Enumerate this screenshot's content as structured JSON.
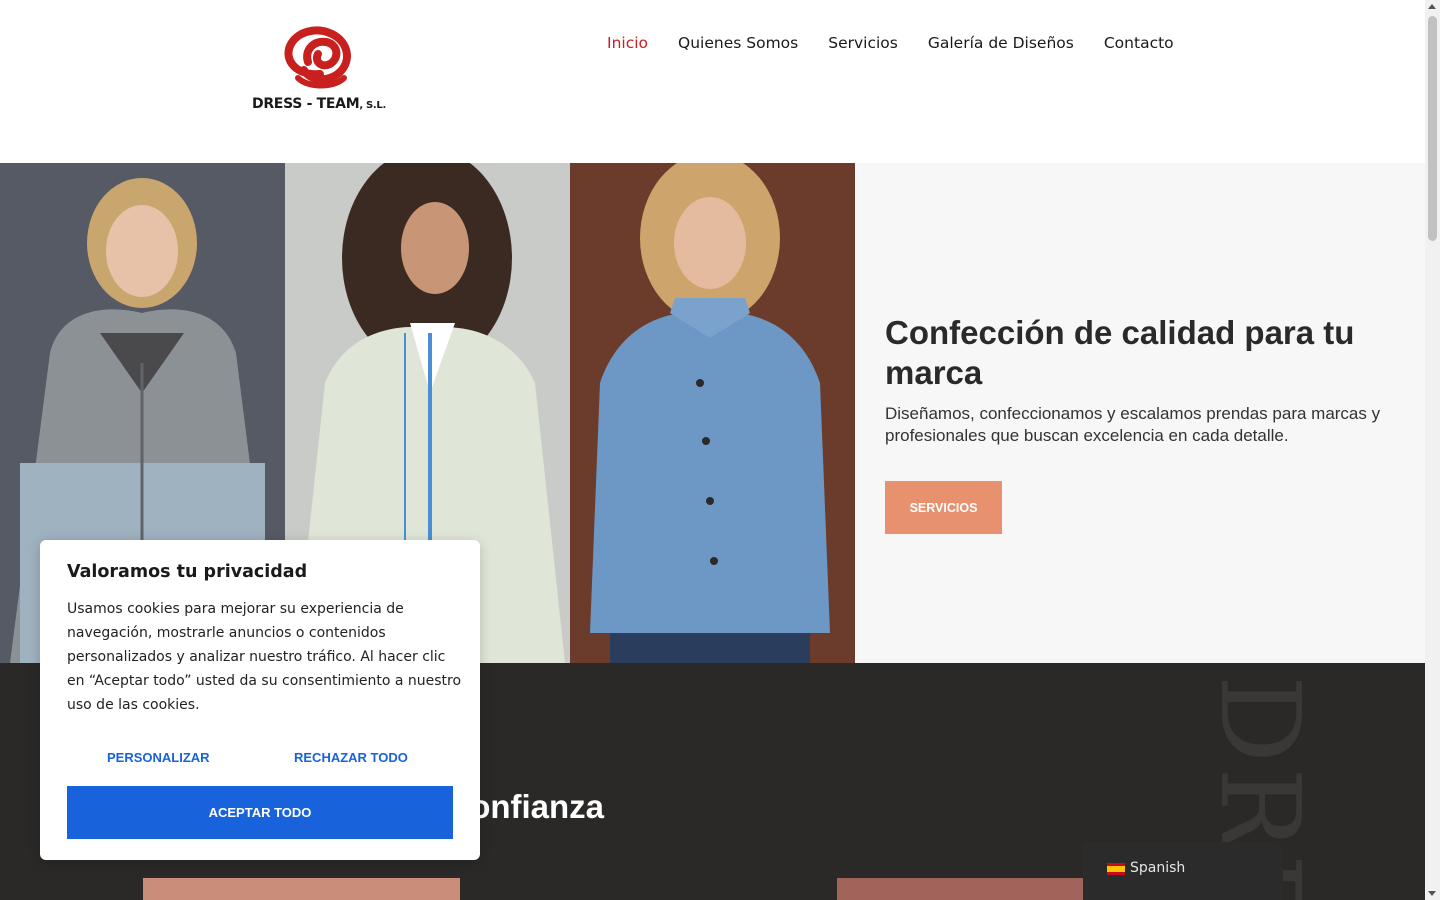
{
  "header": {
    "logo_text": "DRESS - TEAM",
    "logo_suffix": ", S.L.",
    "nav": [
      {
        "label": "Inicio",
        "active": true
      },
      {
        "label": "Quienes Somos"
      },
      {
        "label": "Servicios"
      },
      {
        "label": "Galería de Diseños"
      },
      {
        "label": "Contacto"
      }
    ]
  },
  "hero": {
    "title": "Confección de calidad para tu marca",
    "subtitle": "Diseñamos, confeccionamos y escalamos prendas para marcas y profesionales que buscan excelencia en cada detalle.",
    "button_label": "SERVICIOS"
  },
  "section": {
    "title_visible": "onfianza",
    "watermark": "DRE"
  },
  "cookie": {
    "title": "Valoramos tu privacidad",
    "text": "Usamos cookies para mejorar su experiencia de navegación, mostrarle anuncios o contenidos personalizados y analizar nuestro tráfico. Al hacer clic en “Aceptar todo” usted da su consentimiento a nuestro uso de las cookies.",
    "customize_label": "PERSONALIZAR",
    "reject_label": "RECHAZAR TODO",
    "accept_label": "ACEPTAR TODO"
  },
  "language": {
    "flag_icon": "spain-flag-icon",
    "label": "Spanish"
  },
  "colors": {
    "brand_red": "#c8201e",
    "hero_button": "#e8916e",
    "cookie_blue": "#1863dc",
    "dark_bg": "#2b2928"
  }
}
